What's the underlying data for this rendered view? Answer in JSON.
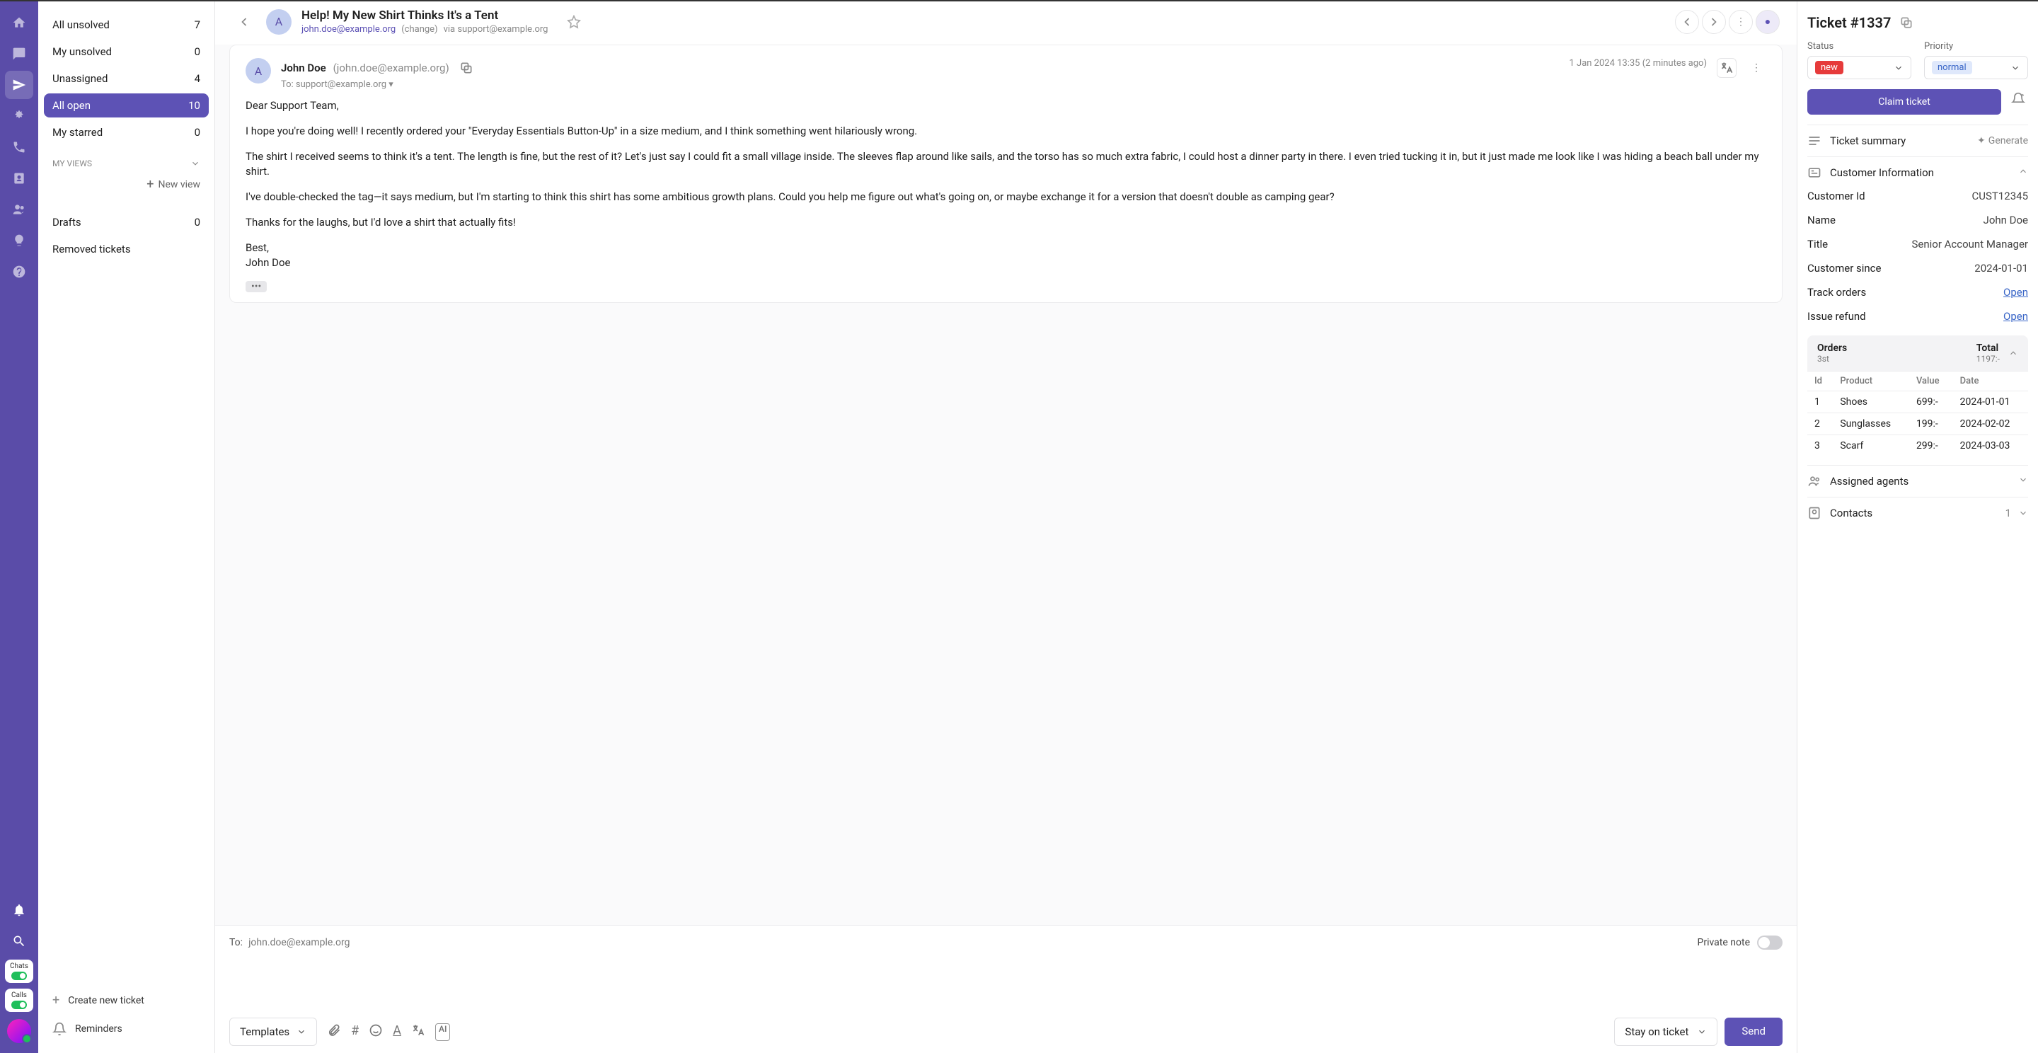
{
  "sidebar": {
    "views": [
      {
        "label": "All unsolved",
        "count": 7,
        "active": false
      },
      {
        "label": "My unsolved",
        "count": 0,
        "active": false
      },
      {
        "label": "Unassigned",
        "count": 4,
        "active": false
      },
      {
        "label": "All open",
        "count": 10,
        "active": true
      },
      {
        "label": "My starred",
        "count": 0,
        "active": false
      }
    ],
    "my_views_label": "MY VIEWS",
    "new_view_label": "New view",
    "drafts": {
      "label": "Drafts",
      "count": 0
    },
    "removed_label": "Removed tickets",
    "create_ticket_label": "Create new ticket",
    "reminders_label": "Reminders"
  },
  "rail": {
    "chats_label": "Chats",
    "calls_label": "Calls"
  },
  "ticket": {
    "subject": "Help! My New Shirt Thinks It's a Tent",
    "from_email": "john.doe@example.org",
    "change_label": "(change)",
    "via_label": "via support@example.org",
    "avatar_letter": "A"
  },
  "message": {
    "author_name": "John Doe",
    "author_email_paren": "(john.doe@example.org)",
    "to_line": "To: support@example.org",
    "timestamp": "1 Jan 2024 13:35 (2 minutes ago)",
    "paragraphs": {
      "p1": "Dear Support Team,",
      "p2": "I hope you're doing well! I recently ordered your \"Everyday Essentials Button-Up\" in a size medium, and I think something went hilariously wrong.",
      "p3": "The shirt I received seems to think it's a tent. The length is fine, but the rest of it? Let's just say I could fit a small village inside. The sleeves flap around like sails, and the torso has so much extra fabric, I could host a dinner party in there. I even tried tucking it in, but it just made me look like I was hiding a beach ball under my shirt.",
      "p4": "I've double-checked the tag—it says medium, but I'm starting to think this shirt has some ambitious growth plans. Could you help me figure out what's going on, or maybe exchange it for a version that doesn't double as camping gear?",
      "p5": "Thanks for the laughs, but I'd love a shirt that actually fits!",
      "p6": "Best,",
      "p7": "John Doe"
    }
  },
  "reply": {
    "to_label": "To:",
    "to_value": "john.doe@example.org",
    "private_note_label": "Private note",
    "templates_label": "Templates",
    "stay_label": "Stay on ticket",
    "send_label": "Send"
  },
  "right": {
    "ticket_number": "Ticket #1337",
    "status_label": "Status",
    "status_value": "new",
    "priority_label": "Priority",
    "priority_value": "normal",
    "claim_label": "Claim ticket",
    "summary_label": "Ticket summary",
    "generate_label": "Generate",
    "customer_info_label": "Customer Information",
    "customer": {
      "id_label": "Customer Id",
      "id_value": "CUST12345",
      "name_label": "Name",
      "name_value": "John Doe",
      "title_label": "Title",
      "title_value": "Senior Account Manager",
      "since_label": "Customer since",
      "since_value": "2024-01-01",
      "track_label": "Track orders",
      "track_link": "Open",
      "refund_label": "Issue refund",
      "refund_link": "Open"
    },
    "orders_box": {
      "orders_label": "Orders",
      "orders_sub": "3st",
      "total_label": "Total",
      "total_sub": "1197:-",
      "headers": {
        "id": "Id",
        "product": "Product",
        "value": "Value",
        "date": "Date"
      },
      "rows": [
        {
          "id": "1",
          "product": "Shoes",
          "value": "699:-",
          "date": "2024-01-01"
        },
        {
          "id": "2",
          "product": "Sunglasses",
          "value": "199:-",
          "date": "2024-02-02"
        },
        {
          "id": "3",
          "product": "Scarf",
          "value": "299:-",
          "date": "2024-03-03"
        }
      ]
    },
    "agents_label": "Assigned agents",
    "contacts_label": "Contacts",
    "contacts_count": "1"
  }
}
